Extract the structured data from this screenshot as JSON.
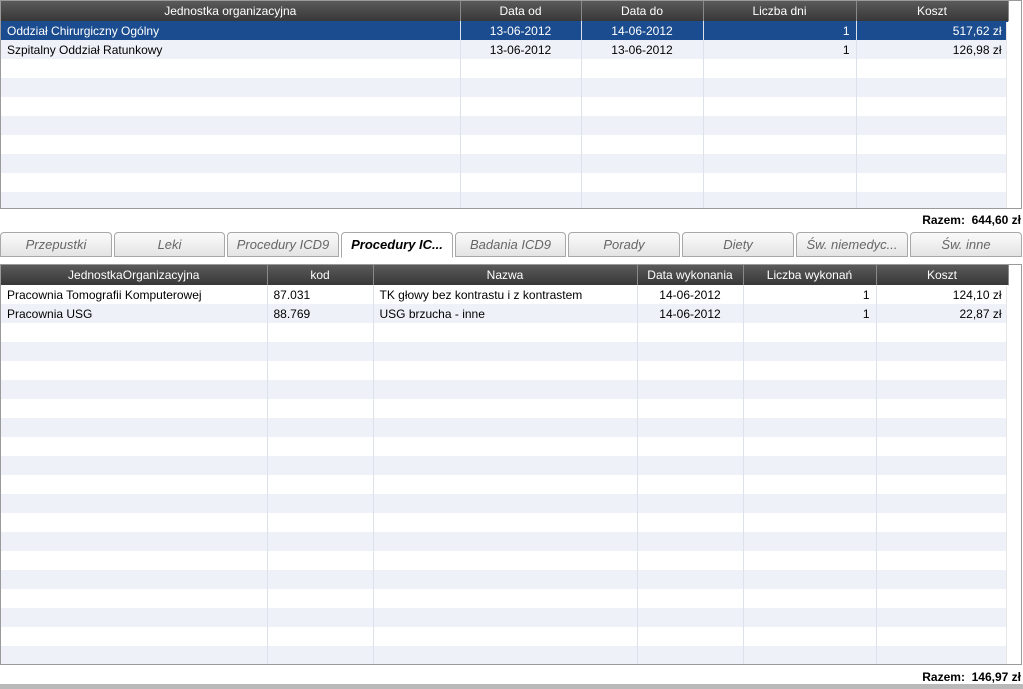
{
  "stays": {
    "columns": [
      "Jednostka organizacyjna",
      "Data od",
      "Data do",
      "Liczba dni",
      "Koszt"
    ],
    "rows": [
      {
        "unit": "Oddział Chirurgiczny Ogólny",
        "from": "13-06-2012",
        "to": "14-06-2012",
        "days": "1",
        "cost": "517,62 zł"
      },
      {
        "unit": "Szpitalny Oddział Ratunkowy",
        "from": "13-06-2012",
        "to": "13-06-2012",
        "days": "1",
        "cost": "126,98 zł"
      }
    ],
    "total_label": "Razem:",
    "total_value": "644,60 zł"
  },
  "tabs": [
    {
      "label": "Przepustki"
    },
    {
      "label": "Leki"
    },
    {
      "label": "Procedury ICD9"
    },
    {
      "label": "Procedury IC..."
    },
    {
      "label": "Badania ICD9"
    },
    {
      "label": "Porady"
    },
    {
      "label": "Diety"
    },
    {
      "label": "Św. niemedyc..."
    },
    {
      "label": "Św. inne"
    }
  ],
  "procedures": {
    "columns": [
      "JednostkaOrganizacyjna",
      "kod",
      "Nazwa",
      "Data wykonania",
      "Liczba wykonań",
      "Koszt"
    ],
    "rows": [
      {
        "unit": "Pracownia Tomografii Komputerowej",
        "code": "87.031",
        "name": "TK głowy bez kontrastu i z kontrastem",
        "date": "14-06-2012",
        "count": "1",
        "cost": "124,10 zł"
      },
      {
        "unit": "Pracownia USG",
        "code": "88.769",
        "name": "USG brzucha - inne",
        "date": "14-06-2012",
        "count": "1",
        "cost": "22,87 zł"
      }
    ],
    "total_label": "Razem:",
    "total_value": "146,97 zł"
  }
}
